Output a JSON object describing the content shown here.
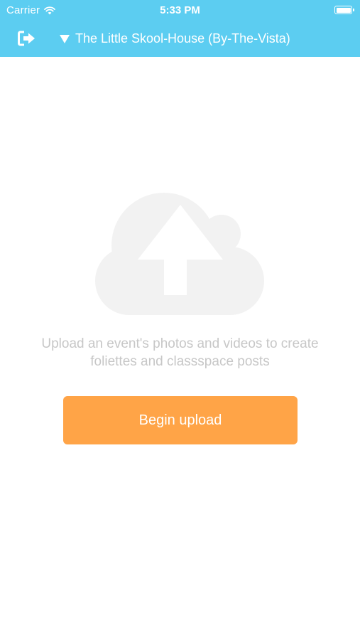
{
  "status_bar": {
    "carrier": "Carrier",
    "time": "5:33 PM",
    "wifi_icon": "wifi-icon",
    "battery_icon": "battery-icon"
  },
  "nav": {
    "logout_icon": "logout-icon",
    "dropdown_icon": "triangle-down-icon",
    "title": "The Little Skool-House (By-The-Vista)"
  },
  "main": {
    "illustration_icon": "cloud-upload-icon",
    "message_line1": "Upload an event's photos and videos to create",
    "message_line2": "foliettes and classspace posts",
    "button_label": "Begin upload"
  },
  "colors": {
    "header": "#5ccdf1",
    "button": "#ffa447",
    "illustration": "#f2f2f2",
    "message_text": "#c7c7c7"
  }
}
